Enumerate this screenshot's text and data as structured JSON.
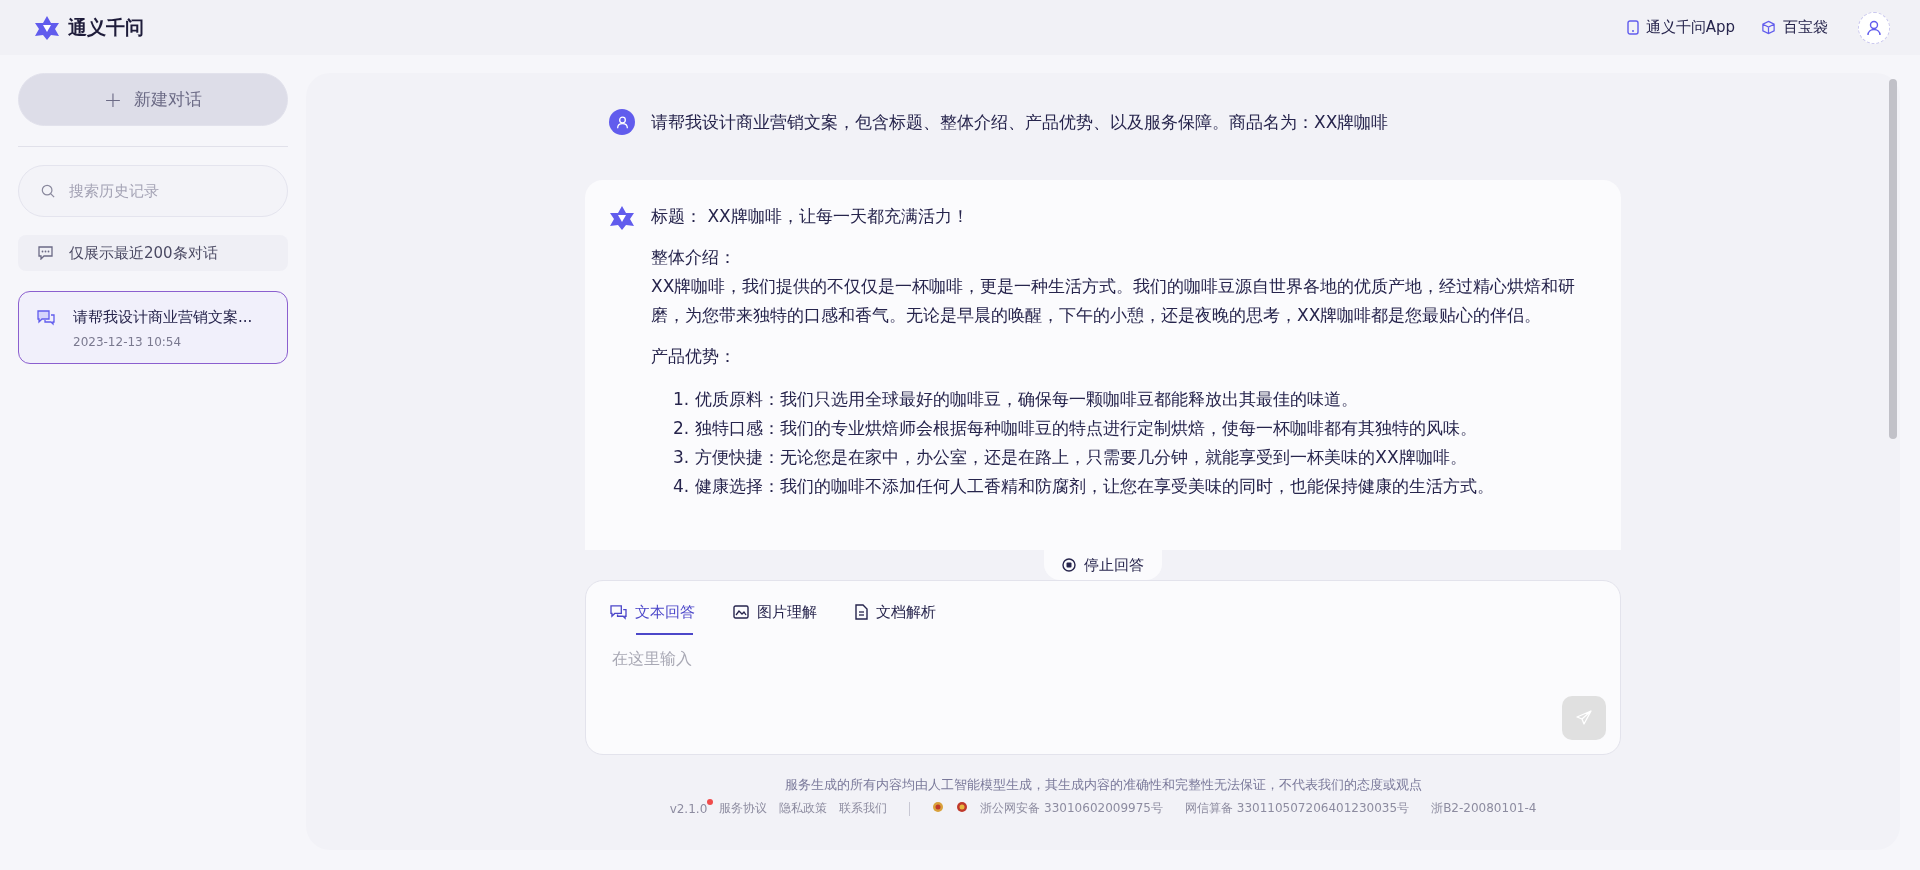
{
  "header": {
    "logo_text": "通义千问",
    "links": [
      {
        "kind": "app",
        "label": "通义千问App"
      },
      {
        "kind": "box",
        "label": "百宝袋"
      }
    ]
  },
  "sidebar": {
    "new_chat": {
      "icon": "+",
      "label": "新建对话"
    },
    "search": {
      "placeholder": "搜索历史记录"
    },
    "notice": "仅展示最近200条对话",
    "conversations": [
      {
        "title": "请帮我设计商业营销文案...",
        "time": "2023-12-13 10:54",
        "selected": true
      }
    ]
  },
  "chat": {
    "user_message": "请帮我设计商业营销文案，包含标题、整体介绍、产品优势、以及服务保障。商品名为：XX牌咖啡",
    "answer": {
      "title_line": "标题： XX牌咖啡，让每一天都充满活力！",
      "intro_heading": "整体介绍：",
      "intro_body": "XX牌咖啡，我们提供的不仅仅是一杯咖啡，更是一种生活方式。我们的咖啡豆源自世界各地的优质产地，经过精心烘焙和研磨，为您带来独特的口感和香气。无论是早晨的唤醒，下午的小憩，还是夜晚的思考，XX牌咖啡都是您最贴心的伴侣。",
      "advantages_heading": "产品优势：",
      "advantages": [
        {
          "number": "1.",
          "text": "优质原料：我们只选用全球最好的咖啡豆，确保每一颗咖啡豆都能释放出其最佳的味道。"
        },
        {
          "number": "2.",
          "text": "独特口感：我们的专业烘焙师会根据每种咖啡豆的特点进行定制烘焙，使每一杯咖啡都有其独特的风味。"
        },
        {
          "number": "3.",
          "text": "方便快捷：无论您是在家中，办公室，还是在路上，只需要几分钟，就能享受到一杯美味的XX牌咖啡。"
        },
        {
          "number": "4.",
          "text": "健康选择：我们的咖啡不添加任何人工香精和防腐剂，让您在享受美味的同时，也能保持健康的生活方式。"
        }
      ]
    },
    "stop_button": "停止回答",
    "input": {
      "tabs": [
        {
          "kind": "chat",
          "label": "文本回答",
          "selected": true
        },
        {
          "kind": "image",
          "label": "图片理解",
          "selected": false
        },
        {
          "kind": "doc",
          "label": "文档解析",
          "selected": false
        }
      ],
      "placeholder": "在这里输入",
      "send_disabled": true
    }
  },
  "footer": {
    "disclaimer": "服务生成的所有内容均由人工智能模型生成，其生成内容的准确性和完整性无法保证，不代表我们的态度或观点",
    "version": "v2.1.0",
    "version_has_update": true,
    "links": [
      "服务协议",
      "隐私政策",
      "联系我们"
    ],
    "registrations": [
      "浙公网安备 33010602009975号",
      "网信算备 330110507206401230035号",
      "浙B2-20080101-4"
    ]
  }
}
